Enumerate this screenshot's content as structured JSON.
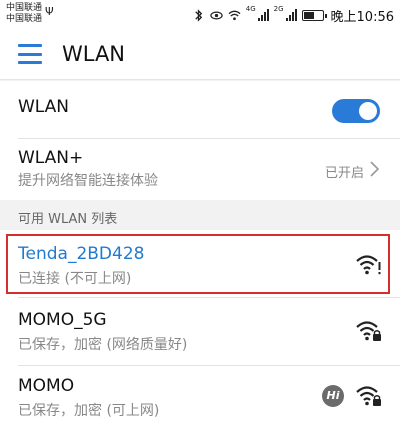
{
  "status_bar": {
    "carrier_1": "中国联通",
    "carrier_2": "中国联通",
    "signal_label_1": "4G",
    "signal_label_2": "2G",
    "battery_level": 0.6,
    "time": "晚上10:56"
  },
  "app_bar": {
    "title": "WLAN"
  },
  "wlan_switch": {
    "label": "WLAN",
    "on": true
  },
  "wlan_plus": {
    "label": "WLAN+",
    "subtitle": "提升网络智能连接体验",
    "state": "已开启"
  },
  "section_header": "可用 WLAN 列表",
  "networks": [
    {
      "ssid": "Tenda_2BD428",
      "status": "已连接 (不可上网)",
      "highlighted": true,
      "locked": false,
      "warning": true,
      "color": "#1f7bd1"
    },
    {
      "ssid": "MOMO_5G",
      "status": "已保存，加密 (网络质量好)",
      "highlighted": false,
      "locked": true,
      "warning": false,
      "color": "#111111"
    },
    {
      "ssid": "MOMO",
      "status": "已保存，加密 (可上网)",
      "highlighted": false,
      "locked": true,
      "warning": false,
      "hl_badge": "Hi",
      "color": "#111111"
    }
  ],
  "colors": {
    "accent": "#2a7bd8",
    "highlight_border": "#d32f2f"
  }
}
